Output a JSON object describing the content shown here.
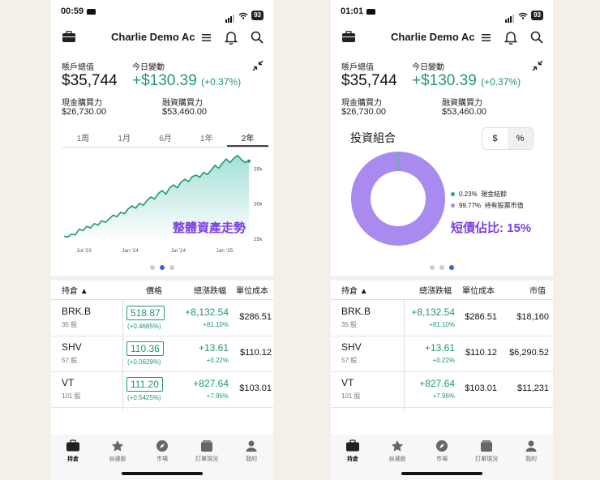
{
  "left": {
    "time": "00:59",
    "battery": "93",
    "account_name": "Charlie Demo Ac",
    "total_label": "賬戶總值",
    "total_value": "$35,744",
    "today_label": "今日變動",
    "today_change": "+$130.39",
    "today_pct": "(+0.37%)",
    "cash_bp_label": "現金購買力",
    "cash_bp_value": "$26,730.00",
    "margin_bp_label": "融資購買力",
    "margin_bp_value": "$53,460.00",
    "tabs": [
      "1周",
      "1月",
      "6月",
      "1年",
      "2年"
    ],
    "chart_overlay": "整體資產走勢",
    "table_headers": {
      "holdings": "持倉 ▲",
      "price": "價格",
      "total_change": "總漲跌幅",
      "unit_cost": "單位成本"
    },
    "rows": [
      {
        "symbol": "BRK.B",
        "shares": "35 股",
        "price": "518.87",
        "price_pct": "(+0.4685%)",
        "gain": "+8,132.54",
        "gain_pct": "+81.10%",
        "cost": "$286.51"
      },
      {
        "symbol": "SHV",
        "shares": "57 股",
        "price": "110.36",
        "price_pct": "(+0.0629%)",
        "gain": "+13.61",
        "gain_pct": "+0.22%",
        "cost": "$110.12"
      },
      {
        "symbol": "VT",
        "shares": "101 股",
        "price": "111.20",
        "price_pct": "(+0.5425%)",
        "gain": "+827.64",
        "gain_pct": "+7.96%",
        "cost": "$103.01"
      }
    ]
  },
  "right": {
    "time": "01:01",
    "battery": "93",
    "account_name": "Charlie Demo Ac",
    "total_label": "賬戶總值",
    "total_value": "$35,744",
    "today_label": "今日變動",
    "today_change": "+$130.39",
    "today_pct": "(+0.37%)",
    "cash_bp_label": "現金購買力",
    "cash_bp_value": "$26,730.00",
    "margin_bp_label": "融資購買力",
    "margin_bp_value": "$53,460.00",
    "portfolio_title": "投資組合",
    "toggle_dollar": "$",
    "toggle_pct": "%",
    "legend": [
      {
        "pct": "0.23%",
        "label": "現金結餘",
        "color": "#2fa37a"
      },
      {
        "pct": "99.77%",
        "label": "持有股票市值",
        "color": "#a98bf0"
      }
    ],
    "pie_overlay": "短債佔比: 15%",
    "table_headers": {
      "holdings": "持倉 ▲",
      "total_change": "總漲跌幅",
      "unit_cost": "單位成本",
      "market_value": "市值"
    },
    "rows": [
      {
        "symbol": "BRK.B",
        "shares": "35 股",
        "gain": "+8,132.54",
        "gain_pct": "+81.10%",
        "cost": "$286.51",
        "mv": "$18,160"
      },
      {
        "symbol": "SHV",
        "shares": "57 股",
        "gain": "+13.61",
        "gain_pct": "+0.22%",
        "cost": "$110.12",
        "mv": "$6,290.52"
      },
      {
        "symbol": "VT",
        "shares": "101 股",
        "gain": "+827.64",
        "gain_pct": "+7.96%",
        "cost": "$103.01",
        "mv": "$11,231"
      }
    ]
  },
  "nav": [
    "持倉",
    "自選股",
    "市場",
    "訂單現況",
    "我的"
  ],
  "chart_data": {
    "type": "area",
    "title": "",
    "x_ticks": [
      "Jul '23",
      "Jan '24",
      "Jul '24",
      "Jan '25"
    ],
    "y_ticks": [
      "35k",
      "30k",
      "25k"
    ],
    "ylim": [
      25000,
      37000
    ],
    "values": [
      25300,
      25200,
      25600,
      25500,
      26300,
      26100,
      26700,
      26500,
      27100,
      26900,
      27500,
      27300,
      27800,
      28300,
      28100,
      28700,
      28500,
      29200,
      29600,
      29300,
      30000,
      29700,
      30400,
      30900,
      30600,
      31400,
      31800,
      31300,
      32200,
      32600,
      32200,
      33000,
      33400,
      33100,
      33800,
      34000,
      33700,
      34400,
      34100,
      34700,
      35400,
      35000,
      35700,
      36300,
      35800,
      36400,
      36800,
      36200,
      35800,
      36000
    ],
    "accent": "#1f9a6b"
  },
  "donut_data": {
    "type": "pie",
    "values": [
      0.23,
      99.77
    ],
    "colors": [
      "#2fa37a",
      "#a98bf0"
    ]
  }
}
